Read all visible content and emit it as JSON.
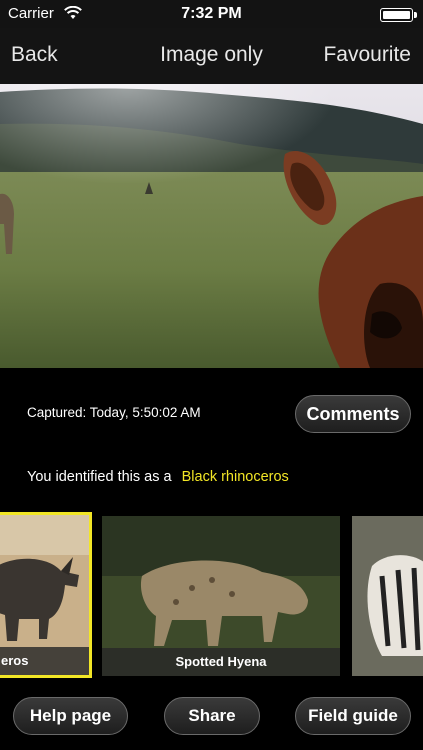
{
  "status_bar": {
    "carrier": "Carrier",
    "time": "7:32 PM",
    "icons": [
      "wifi-icon",
      "battery-icon"
    ]
  },
  "nav": {
    "back_label": "Back",
    "title": "Image only",
    "favourite_label": "Favourite"
  },
  "photo": {
    "description_icon": "camera-trap-photo"
  },
  "info": {
    "captured_text": "Captured: Today, 5:50:02 AM",
    "comments_label": "Comments",
    "identified_prefix": "You identified this as a",
    "identified_species": "Black rhinoceros"
  },
  "thumbnails": [
    {
      "caption": "eros",
      "selected": true
    },
    {
      "caption": "Spotted Hyena",
      "selected": false
    },
    {
      "caption": "",
      "selected": false
    }
  ],
  "bottom_buttons": {
    "help_label": "Help page",
    "share_label": "Share",
    "guide_label": "Field guide"
  },
  "colors": {
    "highlight": "#f2e626",
    "background": "#000000",
    "bar": "#141414"
  }
}
